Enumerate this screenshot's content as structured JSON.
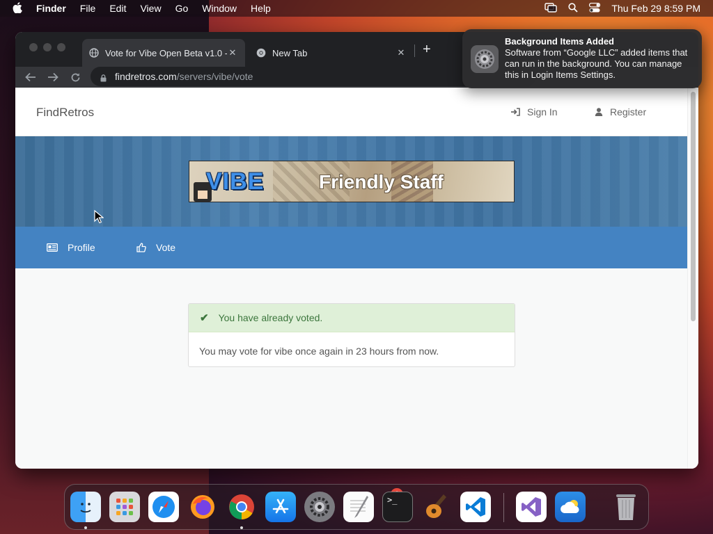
{
  "menubar": {
    "app": "Finder",
    "items": [
      "File",
      "Edit",
      "View",
      "Go",
      "Window",
      "Help"
    ],
    "clock": "Thu Feb 29  8:59 PM"
  },
  "browser": {
    "tabs": [
      {
        "title": "Vote for Vibe Open Beta v1.0 -",
        "active": true
      },
      {
        "title": "New Tab",
        "active": false
      }
    ],
    "url_host": "findretros.com",
    "url_path": "/servers/vibe/vote"
  },
  "site": {
    "brand": "FindRetros",
    "sign_in": "Sign In",
    "register": "Register",
    "banner_logo": "VIBE",
    "banner_slogan": "Friendly Staff",
    "nav_profile": "Profile",
    "nav_vote": "Vote",
    "alert_success": "You have already voted.",
    "alert_message": "You may vote for vibe once again in 23 hours from now."
  },
  "notification": {
    "title": "Background Items Added",
    "body": "Software from “Google LLC” added items that can run in the background. You can manage this in Login Items Settings."
  },
  "dock": {
    "apps": [
      "finder-icon",
      "launchpad-icon",
      "safari-icon",
      "firefox-icon",
      "chrome-icon",
      "app-store-icon",
      "system-settings-icon",
      "textedit-icon",
      "terminal-icon",
      "garageband-icon",
      "vscode-icon",
      "visual-studio-icon",
      "weather-icon",
      "trash-icon"
    ],
    "settings_badge": "1"
  },
  "colors": {
    "accent_blue": "#4483c2",
    "success_bg": "#dff0d8",
    "success_text": "#3c763d"
  }
}
